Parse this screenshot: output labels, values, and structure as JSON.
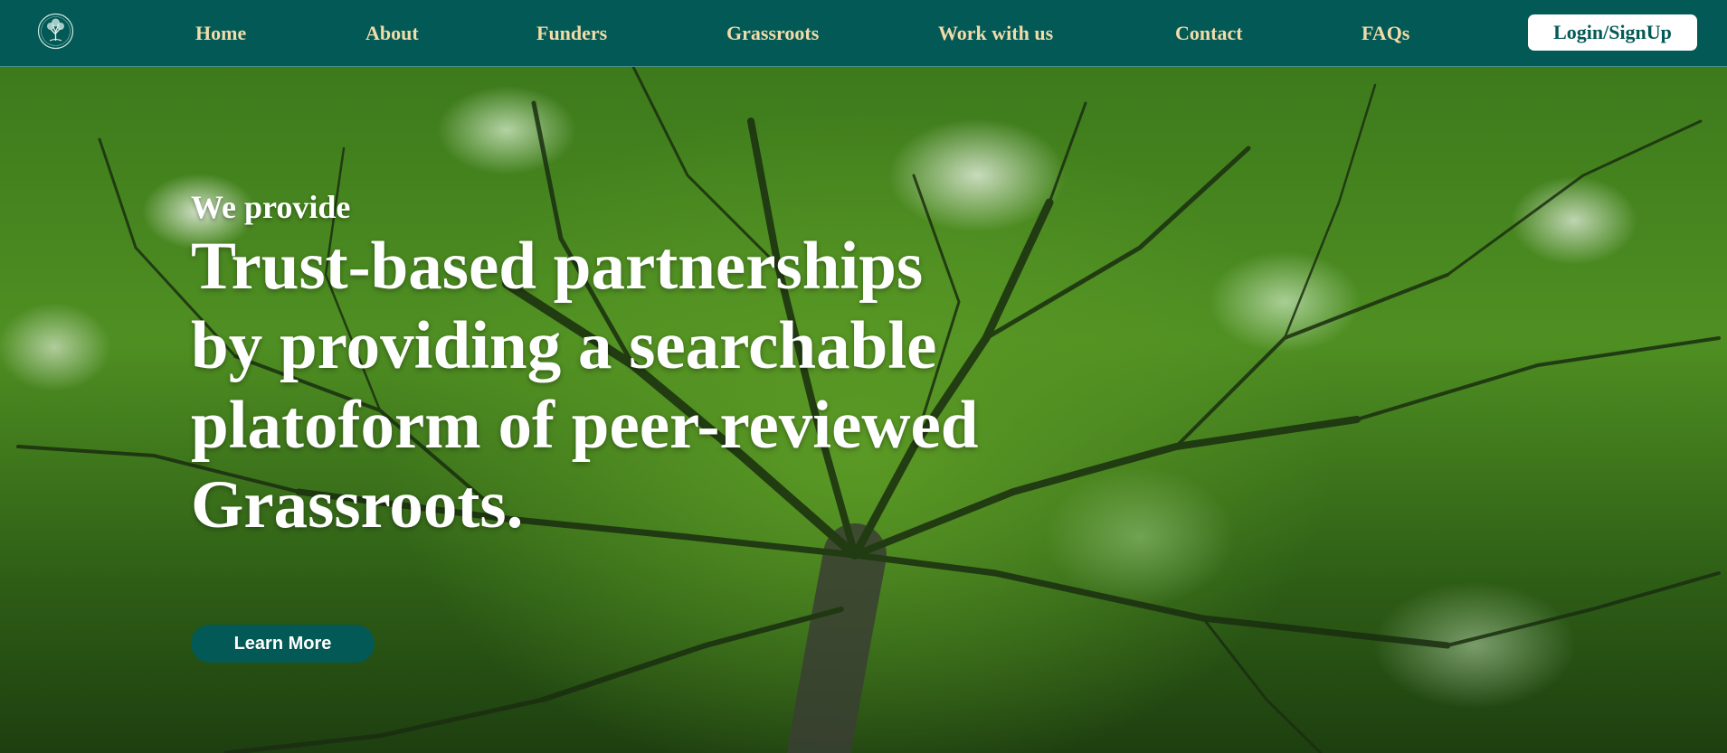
{
  "nav": {
    "logo_icon": "tree-logo-icon",
    "links": [
      {
        "label": "Home"
      },
      {
        "label": "About"
      },
      {
        "label": "Funders"
      },
      {
        "label": "Grassroots"
      },
      {
        "label": "Work with us"
      },
      {
        "label": "Contact"
      },
      {
        "label": "FAQs"
      }
    ],
    "login_label": "Login/SignUp"
  },
  "hero": {
    "eyebrow": "We provide",
    "headline": "Trust-based partnerships by providing a searchable platoform of peer-reviewed Grassroots.",
    "cta_label": "Learn More",
    "background_image": "forest-canopy-photo"
  },
  "colors": {
    "primary": "#035955",
    "nav_text": "#f2dcaa",
    "hero_text": "#ffffff",
    "button_bg": "#ffffff"
  }
}
